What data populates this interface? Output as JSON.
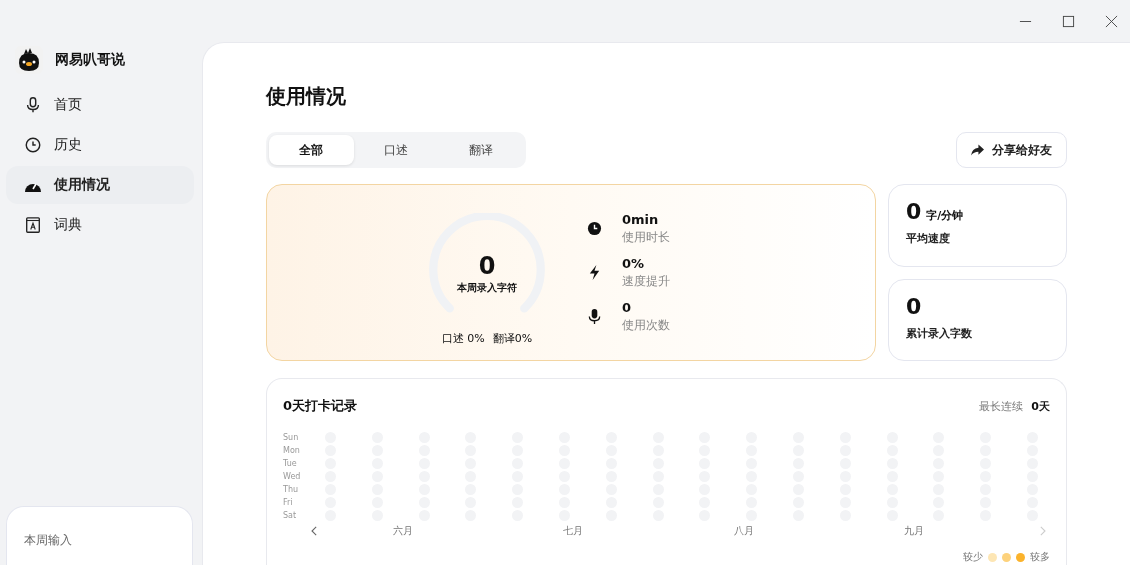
{
  "app": {
    "name": "网易叭哥说"
  },
  "sidebar": {
    "items": [
      {
        "label": "首页",
        "selected": false
      },
      {
        "label": "历史",
        "selected": false
      },
      {
        "label": "使用情况",
        "selected": true
      },
      {
        "label": "词典",
        "selected": false
      }
    ],
    "week_card": {
      "title": "本周输入"
    }
  },
  "page": {
    "title": "使用情况"
  },
  "tabs": [
    {
      "label": "全部",
      "selected": true
    },
    {
      "label": "口述",
      "selected": false
    },
    {
      "label": "翻译",
      "selected": false
    }
  ],
  "share_button": {
    "label": "分享给好友"
  },
  "summary": {
    "value": "0",
    "caption": "本周录入字符",
    "split_dictation": "口述 0%",
    "split_translation": "翻译0%",
    "stats": [
      {
        "value": "0min",
        "label": "使用时长"
      },
      {
        "value": "0%",
        "label": "速度提升"
      },
      {
        "value": "0",
        "label": "使用次数"
      }
    ]
  },
  "speed_card": {
    "value": "0",
    "unit": "字/分钟",
    "label": "平均速度"
  },
  "total_card": {
    "value": "0",
    "label": "累计录入字数"
  },
  "checkin": {
    "title": "0天打卡记录",
    "streak_label": "最长连续",
    "streak_value": "0天",
    "days": [
      "Sun",
      "Mon",
      "Tue",
      "Wed",
      "Thu",
      "Fri",
      "Sat"
    ],
    "months": [
      "六月",
      "七月",
      "八月",
      "九月"
    ],
    "legend_less": "较少",
    "legend_more": "较多",
    "legend": [
      {
        "color": "#fde6b4"
      },
      {
        "color": "#fdd27c"
      },
      {
        "color": "#fbb32c"
      }
    ]
  }
}
